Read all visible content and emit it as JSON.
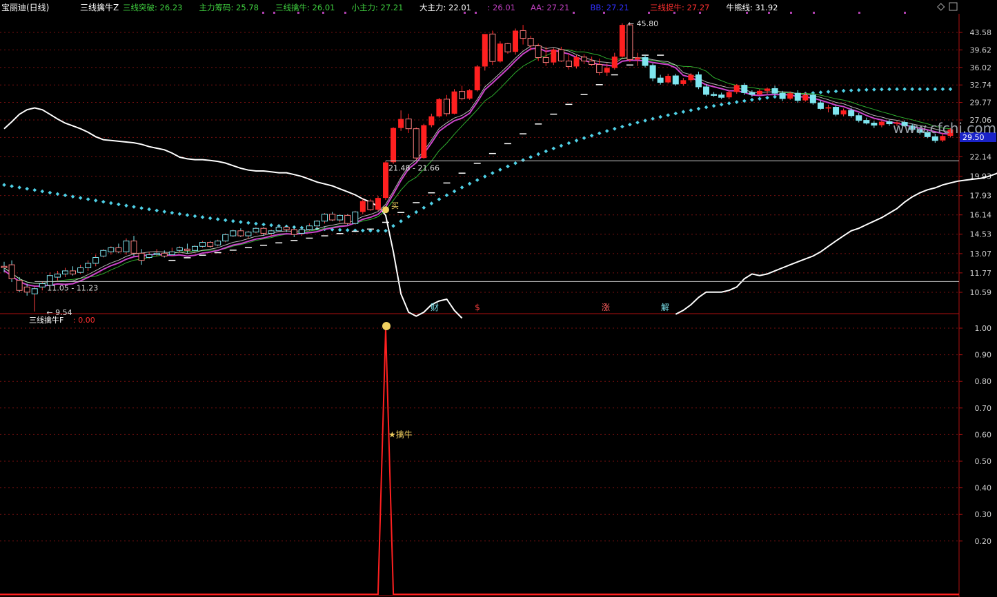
{
  "header": {
    "stock_name": "宝丽迪(日线)",
    "indicator_name": "三线擒牛Z",
    "items": [
      {
        "label": "三线突破",
        "value": "26.23",
        "color": "#3fcf3f"
      },
      {
        "label": "主力筹码",
        "value": "25.78",
        "color": "#3fcf3f"
      },
      {
        "label": "三线擒牛",
        "value": "26.01",
        "color": "#3fcf3f"
      },
      {
        "label": "小主力",
        "value": "27.21",
        "color": "#3fcf3f"
      },
      {
        "label": "大主力",
        "value": "22.01",
        "color": "#ffffff"
      },
      {
        "label": "",
        "value": "26.01",
        "color": "#c040c0"
      },
      {
        "label": "AA",
        "value": "27.21",
        "color": "#c040c0"
      },
      {
        "label": "BB",
        "value": "27.21",
        "color": "#3030ff"
      },
      {
        "label": "三线捉牛",
        "value": "27.27",
        "color": "#ff3030"
      },
      {
        "label": "牛熊线",
        "value": "31.92",
        "color": "#ffffff"
      }
    ]
  },
  "watermark": "www.cfchi.com",
  "price_axis": {
    "ticks": [
      "43.58",
      "39.62",
      "36.02",
      "32.74",
      "29.77",
      "27.06",
      "24.60",
      "22.14",
      "19.93",
      "17.93",
      "16.14",
      "14.53",
      "13.07",
      "11.77",
      "10.59"
    ],
    "current_price": "29.50"
  },
  "annotations": {
    "high_label": "45.80",
    "low_label": "9.54",
    "range_low": "11.05 - 11.23",
    "range_mid": "21.48 - 21.66",
    "buy_label": "买",
    "markers": [
      "财",
      "$",
      "涨",
      "解"
    ]
  },
  "sub_panel": {
    "title": "三线擒牛F",
    "value": "0.00",
    "signal_label": "擒牛",
    "ticks": [
      "1.00",
      "0.90",
      "0.80",
      "0.70",
      "0.60",
      "0.50",
      "0.40",
      "0.30",
      "0.20"
    ]
  },
  "chart_data": [
    {
      "type": "candlestick",
      "title": "三线擒牛Z",
      "ylim": [
        9.54,
        45.8
      ],
      "y_scale": "log",
      "candles": [
        [
          12.2,
          12.5,
          11.8,
          12.1
        ],
        [
          12.3,
          12.6,
          11.2,
          11.4
        ],
        [
          11.3,
          11.5,
          10.6,
          10.7
        ],
        [
          10.9,
          11.1,
          10.4,
          10.6
        ],
        [
          10.5,
          10.9,
          9.54,
          10.8
        ],
        [
          10.9,
          11.2,
          10.7,
          11.1
        ],
        [
          11.0,
          11.8,
          10.9,
          11.6
        ],
        [
          11.5,
          11.9,
          11.3,
          11.7
        ],
        [
          11.7,
          12.1,
          11.5,
          11.9
        ],
        [
          11.9,
          12.2,
          11.6,
          11.7
        ],
        [
          11.8,
          12.3,
          11.7,
          12.1
        ],
        [
          12.1,
          12.6,
          11.9,
          12.4
        ],
        [
          12.4,
          13.0,
          12.2,
          12.8
        ],
        [
          12.9,
          13.4,
          12.8,
          13.3
        ],
        [
          13.2,
          13.6,
          13.0,
          13.5
        ],
        [
          13.5,
          13.8,
          13.1,
          13.2
        ],
        [
          13.2,
          14.2,
          13.0,
          14.0
        ],
        [
          14.0,
          14.4,
          12.9,
          13.1
        ],
        [
          13.1,
          13.4,
          12.3,
          12.6
        ],
        [
          12.8,
          13.2,
          12.7,
          13.0
        ],
        [
          13.0,
          13.4,
          12.9,
          13.1
        ],
        [
          13.1,
          13.3,
          12.8,
          12.9
        ],
        [
          13.0,
          13.5,
          12.9,
          13.2
        ],
        [
          13.3,
          13.6,
          13.2,
          13.5
        ],
        [
          13.4,
          13.8,
          13.1,
          13.3
        ],
        [
          13.3,
          13.7,
          13.2,
          13.6
        ],
        [
          13.6,
          14.0,
          13.5,
          13.9
        ],
        [
          13.9,
          14.0,
          13.5,
          13.6
        ],
        [
          13.7,
          14.1,
          13.6,
          14.0
        ],
        [
          14.0,
          14.6,
          13.9,
          14.5
        ],
        [
          14.4,
          14.9,
          14.3,
          14.8
        ],
        [
          14.8,
          15.0,
          14.3,
          14.4
        ],
        [
          14.4,
          14.8,
          14.2,
          14.7
        ],
        [
          14.7,
          15.1,
          14.6,
          15.0
        ],
        [
          15.0,
          15.1,
          14.4,
          14.6
        ],
        [
          14.6,
          14.9,
          14.4,
          14.8
        ],
        [
          14.8,
          15.2,
          14.7,
          15.1
        ],
        [
          15.1,
          15.3,
          14.7,
          14.9
        ],
        [
          14.9,
          15.2,
          14.3,
          14.5
        ],
        [
          14.6,
          15.0,
          14.4,
          14.9
        ],
        [
          14.9,
          15.4,
          14.8,
          15.2
        ],
        [
          15.2,
          15.7,
          15.0,
          15.6
        ],
        [
          15.6,
          16.3,
          15.4,
          16.2
        ],
        [
          16.2,
          16.4,
          15.6,
          15.7
        ],
        [
          15.7,
          16.2,
          15.5,
          16.1
        ],
        [
          16.1,
          16.2,
          15.3,
          15.4
        ],
        [
          15.4,
          16.5,
          15.3,
          16.4
        ],
        [
          16.4,
          17.6,
          16.2,
          17.4
        ],
        [
          17.4,
          17.6,
          16.5,
          16.6
        ],
        [
          16.6,
          17.9,
          16.5,
          17.7
        ],
        [
          17.7,
          21.66,
          17.5,
          21.48
        ],
        [
          21.5,
          26.0,
          21.3,
          25.9
        ],
        [
          25.9,
          28.5,
          25.5,
          27.2
        ],
        [
          27.2,
          28.0,
          25.2,
          25.8
        ],
        [
          25.8,
          26.0,
          21.8,
          22.0
        ],
        [
          22.0,
          26.5,
          21.9,
          26.3
        ],
        [
          26.3,
          28.0,
          26.0,
          27.6
        ],
        [
          27.6,
          30.5,
          27.4,
          30.3
        ],
        [
          30.3,
          31.0,
          27.6,
          28.0
        ],
        [
          28.0,
          32.0,
          27.9,
          31.6
        ],
        [
          31.6,
          32.6,
          30.1,
          30.4
        ],
        [
          30.4,
          32.0,
          30.2,
          31.8
        ],
        [
          31.8,
          36.5,
          31.6,
          36.2
        ],
        [
          36.2,
          39.6,
          35.4,
          43.2
        ],
        [
          43.2,
          44.0,
          36.5,
          37.2
        ],
        [
          37.2,
          41.5,
          37.0,
          41.0
        ],
        [
          41.0,
          41.2,
          38.8,
          39.2
        ],
        [
          39.2,
          44.5,
          38.6,
          44.0
        ],
        [
          44.0,
          45.4,
          40.8,
          42.2
        ],
        [
          42.2,
          42.8,
          39.5,
          40.5
        ],
        [
          40.5,
          41.0,
          37.3,
          38.0
        ],
        [
          38.0,
          40.3,
          36.3,
          37.0
        ],
        [
          37.0,
          40.0,
          36.5,
          39.7
        ],
        [
          39.7,
          40.3,
          37.1,
          37.3
        ],
        [
          37.3,
          38.8,
          35.6,
          36.2
        ],
        [
          36.2,
          38.5,
          35.8,
          38.1
        ],
        [
          38.1,
          38.7,
          36.7,
          37.3
        ],
        [
          37.3,
          38.2,
          36.3,
          36.6
        ],
        [
          36.6,
          37.8,
          34.5,
          35.0
        ],
        [
          35.0,
          36.8,
          34.4,
          35.9
        ],
        [
          35.9,
          39.0,
          35.6,
          38.2
        ],
        [
          38.2,
          45.8,
          38.0,
          45.4
        ],
        [
          45.4,
          45.8,
          37.1,
          37.6
        ],
        [
          37.6,
          39.0,
          36.3,
          38.0
        ],
        [
          38.0,
          38.5,
          36.0,
          36.4
        ],
        [
          36.4,
          36.8,
          33.4,
          34.0
        ],
        [
          34.0,
          34.6,
          32.8,
          33.2
        ],
        [
          33.2,
          34.8,
          33.0,
          34.4
        ],
        [
          34.4,
          34.8,
          32.6,
          32.9
        ],
        [
          32.9,
          34.0,
          32.6,
          33.6
        ],
        [
          33.6,
          34.9,
          33.2,
          34.6
        ],
        [
          34.6,
          35.2,
          32.0,
          32.4
        ],
        [
          32.4,
          32.9,
          30.8,
          31.1
        ],
        [
          31.1,
          31.5,
          30.7,
          31.0
        ],
        [
          31.0,
          31.4,
          30.3,
          30.6
        ],
        [
          30.6,
          31.8,
          30.3,
          31.5
        ],
        [
          31.5,
          32.9,
          31.2,
          32.7
        ],
        [
          32.7,
          33.1,
          31.0,
          31.4
        ],
        [
          31.4,
          31.8,
          30.7,
          31.1
        ],
        [
          31.1,
          32.0,
          30.9,
          31.7
        ],
        [
          31.7,
          32.3,
          31.2,
          32.1
        ],
        [
          32.1,
          32.6,
          31.0,
          31.3
        ],
        [
          31.3,
          31.7,
          30.0,
          30.4
        ],
        [
          30.4,
          31.6,
          30.2,
          31.3
        ],
        [
          31.3,
          31.8,
          29.7,
          30.1
        ],
        [
          30.1,
          31.4,
          29.9,
          31.0
        ],
        [
          31.0,
          31.2,
          29.4,
          29.7
        ],
        [
          29.7,
          30.1,
          28.6,
          28.8
        ],
        [
          28.8,
          29.4,
          28.2,
          29.0
        ],
        [
          29.0,
          29.3,
          27.6,
          27.9
        ],
        [
          27.9,
          28.8,
          27.6,
          28.5
        ],
        [
          28.5,
          28.9,
          27.4,
          27.7
        ],
        [
          27.7,
          28.1,
          26.7,
          27.0
        ],
        [
          27.0,
          27.4,
          26.4,
          26.6
        ],
        [
          26.6,
          26.9,
          25.9,
          26.3
        ],
        [
          26.3,
          27.0,
          26.0,
          26.8
        ],
        [
          26.8,
          27.1,
          26.2,
          26.5
        ],
        [
          26.5,
          26.9,
          26.2,
          26.7
        ],
        [
          26.7,
          27.0,
          26.1,
          26.2
        ],
        [
          26.2,
          26.5,
          25.5,
          25.7
        ],
        [
          25.7,
          26.0,
          25.0,
          25.3
        ],
        [
          25.3,
          25.6,
          24.5,
          24.7
        ],
        [
          24.7,
          25.1,
          23.9,
          24.2
        ],
        [
          24.2,
          25.2,
          24.0,
          24.8
        ],
        [
          24.8,
          25.9,
          24.6,
          25.7
        ]
      ]
    },
    {
      "type": "line",
      "title": "三线擒牛F",
      "ylim": [
        0,
        1
      ],
      "x": [
        0,
        49,
        50,
        51
      ],
      "values": [
        0,
        0,
        1,
        0
      ]
    }
  ]
}
